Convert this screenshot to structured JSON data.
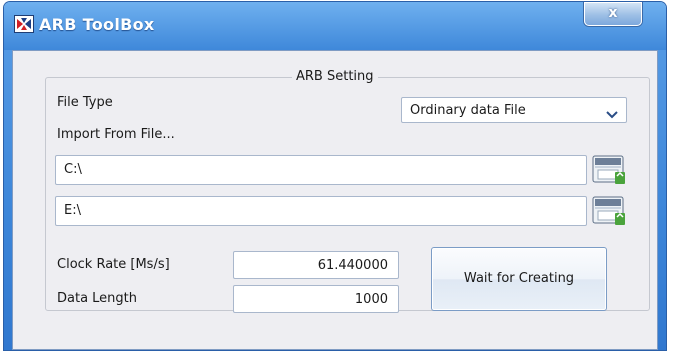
{
  "window": {
    "title": "ARB ToolBox",
    "close_label": "x",
    "accent_color": "#3d86d9"
  },
  "group": {
    "title": "ARB Setting"
  },
  "file_type": {
    "label": "File Type",
    "selected": "Ordinary data File"
  },
  "import": {
    "label": "Import From File...",
    "paths": [
      "C:\\",
      "E:\\"
    ]
  },
  "clock_rate": {
    "label": "Clock Rate [Ms/s]",
    "value": "61.440000"
  },
  "data_length": {
    "label": "Data Length",
    "value": "1000"
  },
  "action": {
    "label": "Wait for Creating"
  },
  "icons": {
    "app": "app-logo-icon",
    "dropdown": "chevron-down-icon",
    "browse": "folder-save-icon"
  }
}
